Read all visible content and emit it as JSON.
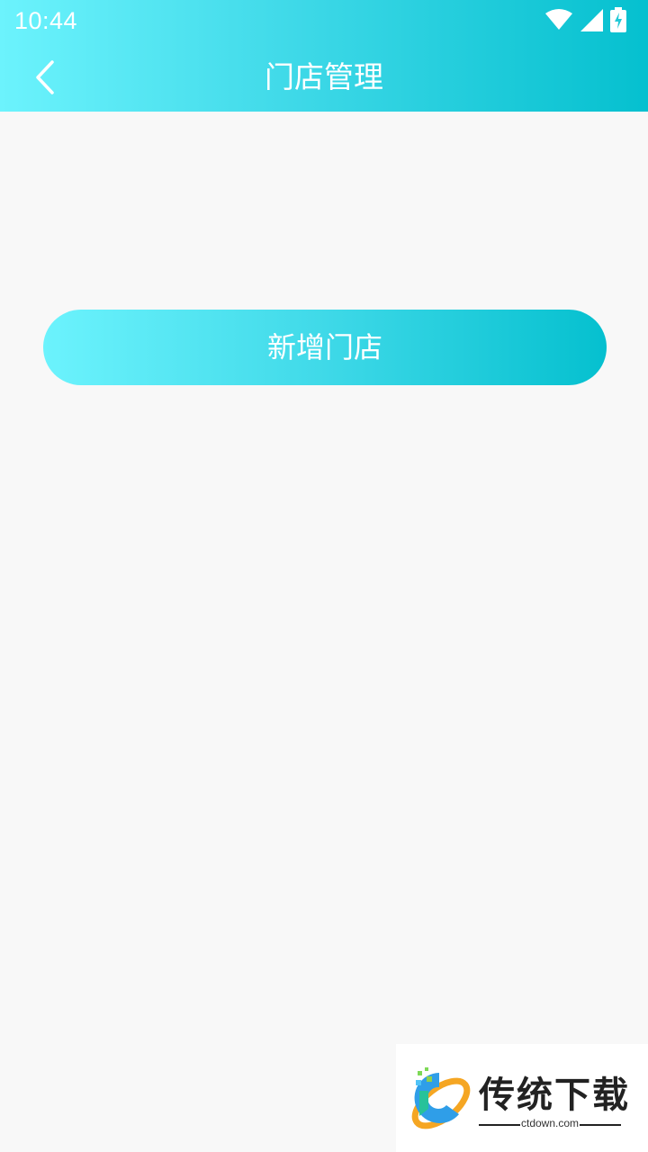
{
  "status_bar": {
    "time": "10:44",
    "icons": [
      "wifi-icon",
      "signal-icon",
      "battery-charging-icon"
    ]
  },
  "nav": {
    "back_icon": "chevron-left-icon",
    "title": "门店管理"
  },
  "main": {
    "add_store_label": "新增门店"
  },
  "colors": {
    "gradient_start": "#6cf3fd",
    "gradient_end": "#05c0cf",
    "background": "#f8f8f8",
    "text_on_accent": "#ffffff"
  },
  "watermark": {
    "name": "传统下载",
    "domain": "ctdown.com"
  }
}
